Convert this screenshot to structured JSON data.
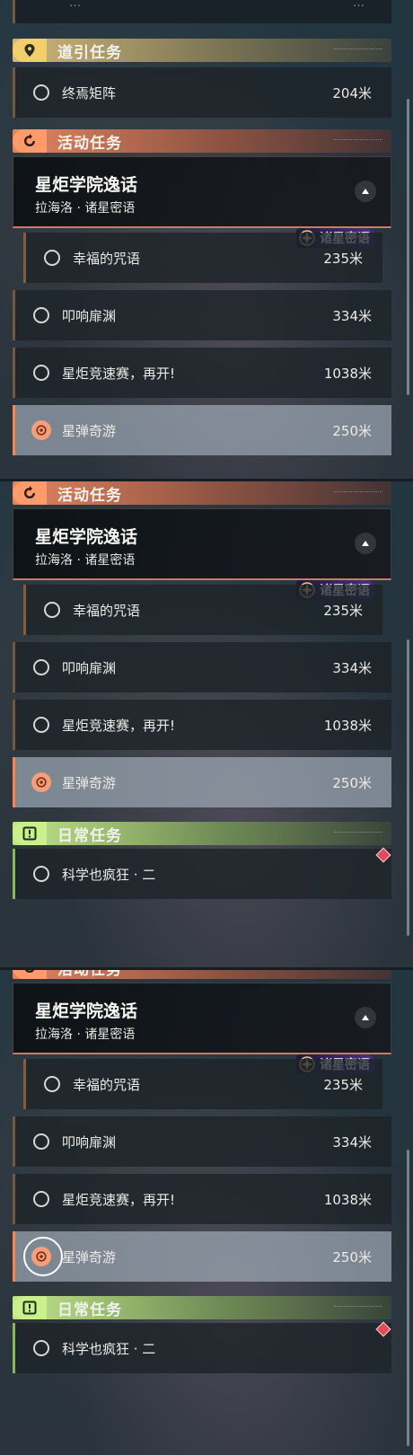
{
  "panels": [
    {
      "partial_row": {
        "title": "…",
        "distance": "…"
      },
      "guide_header": {
        "title": "道引任务",
        "icon": "location-pin-icon"
      },
      "guide_row": {
        "title": "终焉矩阵",
        "distance": "204米"
      },
      "event_header": {
        "title": "活动任务",
        "icon": "swirl-icon"
      },
      "quest_card": {
        "title": "星炬学院逸话",
        "subtitle": "拉海洛 · 诸星密语",
        "badge": "诸星密语"
      },
      "rows": [
        {
          "title": "幸福的咒语",
          "distance": "235米"
        },
        {
          "title": "叩响扉渊",
          "distance": "334米"
        },
        {
          "title": "星炬竞速赛，再开!",
          "distance": "1038米"
        },
        {
          "title": "星弹奇游",
          "distance": "250米"
        }
      ]
    },
    {
      "event_header": {
        "title": "活动任务",
        "icon": "swirl-icon"
      },
      "quest_card": {
        "title": "星炬学院逸话",
        "subtitle": "拉海洛 · 诸星密语",
        "badge": "诸星密语"
      },
      "rows": [
        {
          "title": "幸福的咒语",
          "distance": "235米"
        },
        {
          "title": "叩响扉渊",
          "distance": "334米"
        },
        {
          "title": "星炬竞速赛，再开!",
          "distance": "1038米"
        },
        {
          "title": "星弹奇游",
          "distance": "250米"
        }
      ],
      "daily_header": {
        "title": "日常任务",
        "icon": "exclamation-icon"
      },
      "daily_row": {
        "title": "科学也疯狂 · 二"
      }
    },
    {
      "event_header": {
        "title": "活动任务",
        "icon": "swirl-icon"
      },
      "quest_card": {
        "title": "星炬学院逸话",
        "subtitle": "拉海洛 · 诸星密语",
        "badge": "诸星密语"
      },
      "rows": [
        {
          "title": "幸福的咒语",
          "distance": "235米"
        },
        {
          "title": "叩响扉渊",
          "distance": "334米"
        },
        {
          "title": "星炬竞速赛，再开!",
          "distance": "1038米"
        },
        {
          "title": "星弹奇游",
          "distance": "250米"
        }
      ],
      "daily_header": {
        "title": "日常任务",
        "icon": "exclamation-icon"
      },
      "daily_row": {
        "title": "科学也疯狂 · 二"
      }
    }
  ],
  "colors": {
    "guide": "#f2cf6b",
    "event": "#ff9a6a",
    "daily": "#c9f08a",
    "active_row": "#acbac6"
  }
}
